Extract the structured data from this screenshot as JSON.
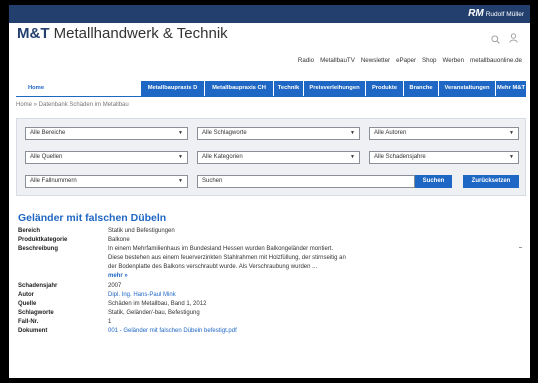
{
  "topbar": {
    "logo_mark": "RM",
    "logo_text": "Rudolf Müller"
  },
  "brand": {
    "title_bold": "M&T",
    "title_rest": " Metallhandwerk & Technik"
  },
  "toplinks": [
    "Radio",
    "MetallbauTV",
    "Newsletter",
    "ePaper",
    "Shop",
    "Werben",
    "metallbauonline.de"
  ],
  "nav": {
    "home": "Home",
    "items": [
      "Metallbaupraxis D",
      "Metallbaupraxis CH",
      "Technik",
      "Preisverleihungen",
      "Produkte",
      "Branche",
      "Veranstaltungen",
      "Mehr M&T"
    ]
  },
  "breadcrumb": "Home  »  Datenbank Schäden im Metallbau",
  "filters": {
    "bereiche": "Alle Bereiche",
    "schlagworte": "Alle Schlagworte",
    "autoren": "Alle Autoren",
    "quellen": "Alle Quellen",
    "kategorien": "Alle Kategorien",
    "schadensjahre": "Alle Schadensjahre",
    "fallnummern": "Alle Fallnummern",
    "search_placeholder": "Suchen",
    "search_button": "Suchen",
    "reset_button": "Zurücksetzen"
  },
  "result": {
    "title": "Geländer mit falschen Dübeln",
    "fields": {
      "bereich": {
        "label": "Bereich",
        "value": "Statik und Befestigungen"
      },
      "produktkategorie": {
        "label": "Produktkategorie",
        "value": "Balkone"
      },
      "beschreibung": {
        "label": "Beschreibung",
        "value": "In einem Mehrfamilienhaus im Bundesland Hessen wurden Balkongeländer montiert. Diese bestehen aus einem feuerverzinkten Stahlrahmen mit Holzfüllung, der stirnseitig an der Bodenplatte des Balkons verschraubt wurde. Als Verschraubung wurden ...",
        "more": "mehr »"
      },
      "schadensjahr": {
        "label": "Schadensjahr",
        "value": "2007"
      },
      "autor": {
        "label": "Autor",
        "value": "Dipl. Ing. Hans-Paul Mink"
      },
      "quelle": {
        "label": "Quelle",
        "value": "Schäden im Metallbau, Band 1, 2012"
      },
      "schlagworte": {
        "label": "Schlagworte",
        "value": "Statik, Geländer/-bau, Befestigung"
      },
      "fallnr": {
        "label": "Fall-Nr.",
        "value": "1"
      },
      "dokument": {
        "label": "Dokument",
        "value": "001 - Geländer mit falschen Dübeln befestigt.pdf"
      }
    }
  },
  "colors": {
    "brand_navy": "#233f6e",
    "accent_blue": "#1f67c4"
  },
  "icons": [
    "search-icon",
    "user-icon",
    "chevron-down-icon"
  ]
}
